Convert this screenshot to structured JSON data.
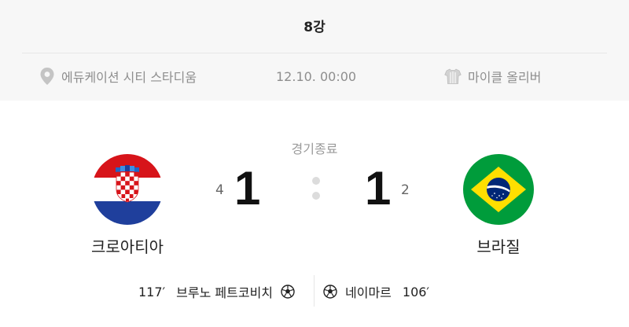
{
  "round": "8강",
  "venue": {
    "icon": "location-pin-icon",
    "label": "에듀케이션 시티 스타디움"
  },
  "datetime": "12.10. 00:00",
  "referee": {
    "icon": "referee-shirt-icon",
    "label": "마이클 올리버"
  },
  "status": "경기종료",
  "home": {
    "name": "크로아티아",
    "flag_icon": "croatia-flag-icon",
    "score": "1",
    "penalty_score": "4",
    "goal": {
      "minute": "117′",
      "player": "브루노 페트코비치"
    }
  },
  "away": {
    "name": "브라질",
    "flag_icon": "brazil-flag-icon",
    "score": "1",
    "penalty_score": "2",
    "goal": {
      "minute": "106′",
      "player": "네이마르"
    }
  },
  "colors": {
    "background_top": "#f7f7f7",
    "muted_text": "#8e8e8e",
    "croatia_red": "#d7141a",
    "croatia_blue": "#1f3f9c",
    "brazil_green": "#009c3b",
    "brazil_yellow": "#ffdf00",
    "brazil_blue": "#002776"
  }
}
